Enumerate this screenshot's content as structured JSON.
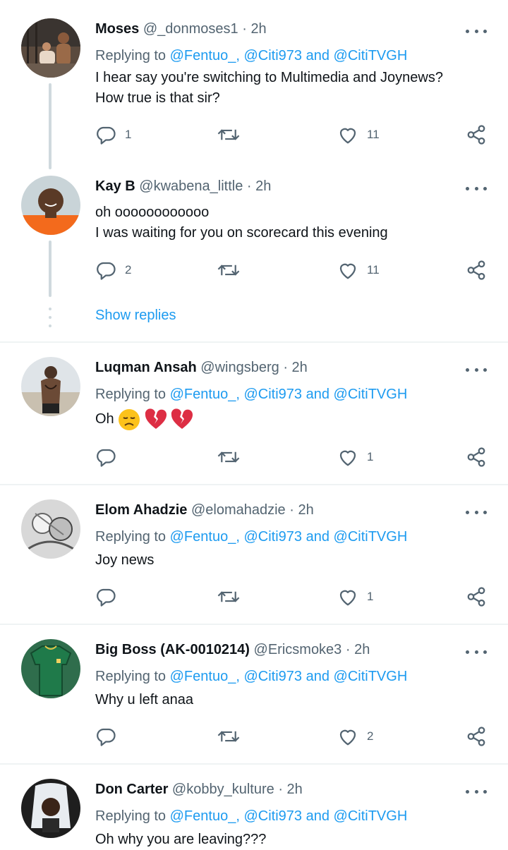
{
  "tweets": [
    {
      "name": "Moses",
      "handle": "@_donmoses1",
      "dot": "·",
      "time": "2h",
      "replying_prefix": "Replying to",
      "mention1": "@Fentuo_",
      "sep1": ",",
      "mention2": "@Citi973",
      "and": "and",
      "mention3": "@CitiTVGH",
      "text_line1": "I hear say you're switching to Multimedia and Joynews?",
      "text_line2": "How true is that sir?",
      "reply_count": "1",
      "like_count": "11"
    },
    {
      "name": "Kay B",
      "handle": "@kwabena_little",
      "dot": "·",
      "time": "2h",
      "text_line1": "oh oooooooooooo",
      "text_line2": "I was waiting for you on scorecard this evening",
      "reply_count": "2",
      "like_count": "11"
    },
    {
      "name": "Luqman Ansah",
      "handle": "@wingsberg",
      "dot": "·",
      "time": "2h",
      "replying_prefix": "Replying to",
      "mention1": "@Fentuo_",
      "sep1": ",",
      "mention2": "@Citi973",
      "and": "and",
      "mention3": "@CitiTVGH",
      "text_line1": "Oh",
      "like_count": "1"
    },
    {
      "name": "Elom Ahadzie",
      "handle": "@elomahadzie",
      "dot": "·",
      "time": "2h",
      "replying_prefix": "Replying to",
      "mention1": "@Fentuo_",
      "sep1": ",",
      "mention2": "@Citi973",
      "and": "and",
      "mention3": "@CitiTVGH",
      "text_line1": "Joy news",
      "like_count": "1"
    },
    {
      "name": "Big Boss (AK-0010214)",
      "handle": "@Ericsmoke3",
      "dot": "·",
      "time": "2h",
      "replying_prefix": "Replying to",
      "mention1": "@Fentuo_",
      "sep1": ",",
      "mention2": "@Citi973",
      "and": "and",
      "mention3": "@CitiTVGH",
      "text_line1": "Why u left anaa",
      "like_count": "2"
    },
    {
      "name": "Don Carter",
      "handle": "@kobby_kulture",
      "dot": "·",
      "time": "2h",
      "replying_prefix": "Replying to",
      "mention1": "@Fentuo_",
      "sep1": ",",
      "mention2": "@Citi973",
      "and": "and",
      "mention3": "@CitiTVGH",
      "text_line1": "Oh why you are leaving???"
    }
  ],
  "show_replies": "Show replies",
  "colors": {
    "accent": "#1d9bf0",
    "muted": "#536471",
    "text": "#0f1419",
    "divider": "#eff3f4"
  }
}
